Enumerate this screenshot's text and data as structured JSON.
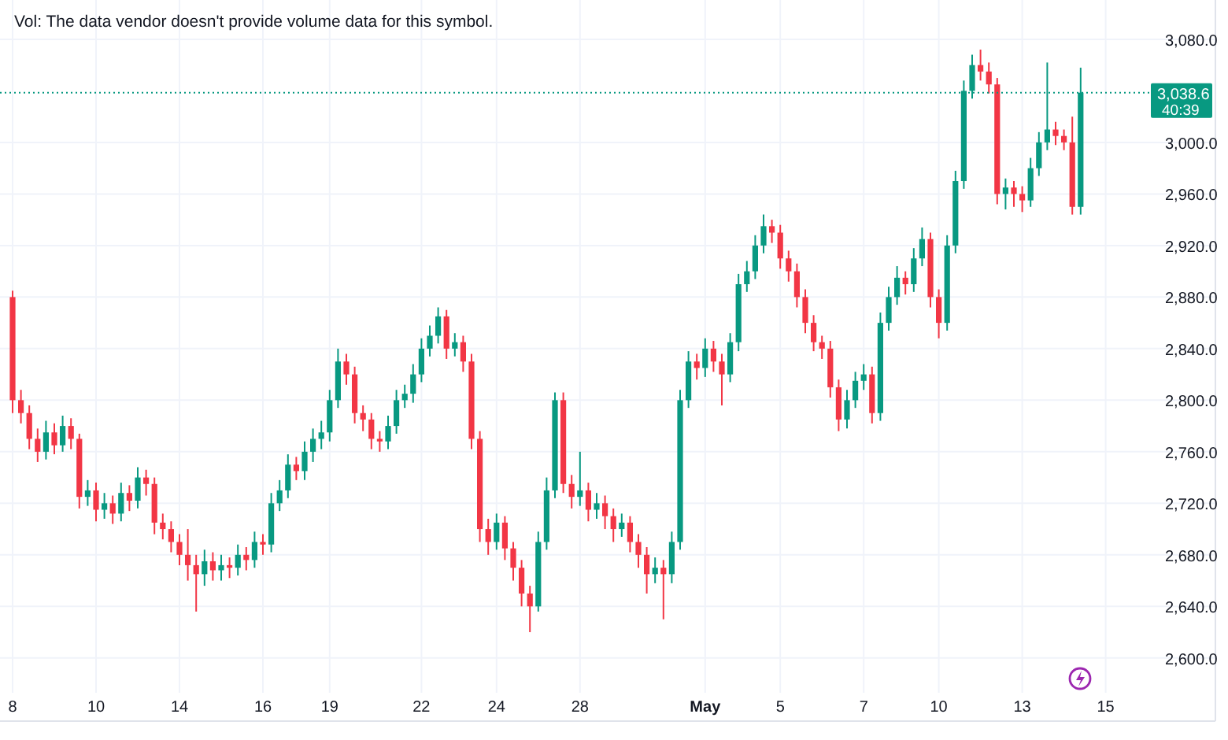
{
  "legend": {
    "volume_note": "Vol: The data vendor doesn't provide volume data for this symbol."
  },
  "chart": {
    "current_price": {
      "price": "3,038.6",
      "countdown": "40:39"
    },
    "chart_data": {
      "type": "candlestick",
      "categories": [
        "8",
        null,
        null,
        null,
        null,
        null,
        null,
        null,
        null,
        null,
        "10",
        null,
        null,
        null,
        null,
        null,
        null,
        null,
        null,
        null,
        "14",
        null,
        null,
        null,
        null,
        null,
        null,
        null,
        null,
        null,
        "16",
        null,
        null,
        null,
        null,
        null,
        null,
        null,
        "19",
        null,
        null,
        null,
        null,
        null,
        null,
        null,
        null,
        null,
        null,
        "22",
        null,
        null,
        null,
        null,
        null,
        null,
        null,
        null,
        "24",
        null,
        null,
        null,
        null,
        null,
        null,
        null,
        null,
        null,
        "28",
        null,
        null,
        null,
        null,
        null,
        null,
        null,
        null,
        null,
        null,
        null,
        null,
        null,
        null,
        "May",
        null,
        null,
        null,
        null,
        null,
        null,
        null,
        null,
        "5",
        null,
        null,
        null,
        null,
        null,
        null,
        null,
        null,
        null,
        "7",
        null,
        null,
        null,
        null,
        null,
        null,
        null,
        null,
        "10",
        null,
        null,
        null,
        null,
        null,
        null,
        null,
        null,
        null,
        "13",
        null,
        null,
        null,
        null,
        null,
        null,
        null,
        null,
        null,
        "15"
      ],
      "ohlc": [
        [
          2880,
          2885,
          2790,
          2800
        ],
        [
          2800,
          2808,
          2782,
          2790
        ],
        [
          2790,
          2796,
          2762,
          2770
        ],
        [
          2770,
          2778,
          2752,
          2760
        ],
        [
          2760,
          2784,
          2754,
          2775
        ],
        [
          2775,
          2782,
          2758,
          2765
        ],
        [
          2765,
          2788,
          2760,
          2780
        ],
        [
          2780,
          2786,
          2762,
          2770
        ],
        [
          2770,
          2774,
          2716,
          2725
        ],
        [
          2725,
          2738,
          2718,
          2730
        ],
        [
          2730,
          2736,
          2706,
          2715
        ],
        [
          2715,
          2728,
          2708,
          2720
        ],
        [
          2720,
          2726,
          2704,
          2712
        ],
        [
          2712,
          2736,
          2706,
          2728
        ],
        [
          2728,
          2734,
          2714,
          2722
        ],
        [
          2722,
          2748,
          2716,
          2740
        ],
        [
          2740,
          2746,
          2726,
          2735
        ],
        [
          2735,
          2740,
          2696,
          2705
        ],
        [
          2705,
          2712,
          2692,
          2700
        ],
        [
          2700,
          2706,
          2682,
          2690
        ],
        [
          2690,
          2696,
          2672,
          2680
        ],
        [
          2680,
          2700,
          2660,
          2672
        ],
        [
          2672,
          2680,
          2636,
          2665
        ],
        [
          2665,
          2684,
          2656,
          2675
        ],
        [
          2675,
          2682,
          2660,
          2668
        ],
        [
          2668,
          2680,
          2660,
          2672
        ],
        [
          2672,
          2678,
          2662,
          2670
        ],
        [
          2670,
          2688,
          2664,
          2680
        ],
        [
          2680,
          2686,
          2668,
          2676
        ],
        [
          2676,
          2698,
          2670,
          2690
        ],
        [
          2690,
          2696,
          2680,
          2688
        ],
        [
          2688,
          2728,
          2682,
          2720
        ],
        [
          2720,
          2738,
          2714,
          2730
        ],
        [
          2730,
          2758,
          2724,
          2750
        ],
        [
          2750,
          2756,
          2738,
          2745
        ],
        [
          2745,
          2768,
          2738,
          2760
        ],
        [
          2760,
          2778,
          2752,
          2770
        ],
        [
          2770,
          2784,
          2762,
          2775
        ],
        [
          2775,
          2808,
          2768,
          2800
        ],
        [
          2800,
          2840,
          2794,
          2830
        ],
        [
          2830,
          2836,
          2812,
          2820
        ],
        [
          2820,
          2826,
          2782,
          2790
        ],
        [
          2790,
          2796,
          2776,
          2785
        ],
        [
          2785,
          2790,
          2762,
          2770
        ],
        [
          2770,
          2776,
          2760,
          2768
        ],
        [
          2768,
          2788,
          2762,
          2780
        ],
        [
          2780,
          2808,
          2774,
          2800
        ],
        [
          2800,
          2812,
          2794,
          2805
        ],
        [
          2805,
          2828,
          2798,
          2820
        ],
        [
          2820,
          2848,
          2814,
          2840
        ],
        [
          2840,
          2858,
          2834,
          2850
        ],
        [
          2850,
          2872,
          2844,
          2865
        ],
        [
          2865,
          2870,
          2832,
          2840
        ],
        [
          2840,
          2852,
          2834,
          2845
        ],
        [
          2845,
          2850,
          2822,
          2830
        ],
        [
          2830,
          2836,
          2762,
          2770
        ],
        [
          2770,
          2776,
          2690,
          2700
        ],
        [
          2700,
          2708,
          2680,
          2690
        ],
        [
          2690,
          2712,
          2684,
          2705
        ],
        [
          2705,
          2710,
          2676,
          2685
        ],
        [
          2685,
          2690,
          2660,
          2670
        ],
        [
          2670,
          2676,
          2640,
          2650
        ],
        [
          2650,
          2656,
          2620,
          2640
        ],
        [
          2640,
          2698,
          2636,
          2690
        ],
        [
          2690,
          2740,
          2684,
          2730
        ],
        [
          2730,
          2806,
          2724,
          2800
        ],
        [
          2800,
          2806,
          2728,
          2735
        ],
        [
          2735,
          2742,
          2716,
          2725
        ],
        [
          2725,
          2760,
          2718,
          2730
        ],
        [
          2730,
          2736,
          2706,
          2715
        ],
        [
          2715,
          2728,
          2708,
          2720
        ],
        [
          2720,
          2726,
          2700,
          2710
        ],
        [
          2710,
          2716,
          2690,
          2700
        ],
        [
          2700,
          2712,
          2694,
          2705
        ],
        [
          2705,
          2710,
          2682,
          2690
        ],
        [
          2690,
          2696,
          2670,
          2680
        ],
        [
          2680,
          2686,
          2650,
          2665
        ],
        [
          2665,
          2678,
          2658,
          2670
        ],
        [
          2670,
          2676,
          2630,
          2665
        ],
        [
          2665,
          2698,
          2658,
          2690
        ],
        [
          2690,
          2808,
          2684,
          2800
        ],
        [
          2800,
          2838,
          2794,
          2830
        ],
        [
          2830,
          2836,
          2816,
          2825
        ],
        [
          2825,
          2848,
          2818,
          2840
        ],
        [
          2840,
          2846,
          2822,
          2830
        ],
        [
          2830,
          2836,
          2796,
          2820
        ],
        [
          2820,
          2852,
          2814,
          2845
        ],
        [
          2845,
          2898,
          2838,
          2890
        ],
        [
          2890,
          2908,
          2884,
          2900
        ],
        [
          2900,
          2928,
          2894,
          2920
        ],
        [
          2920,
          2944,
          2914,
          2935
        ],
        [
          2935,
          2940,
          2922,
          2930
        ],
        [
          2930,
          2936,
          2902,
          2910
        ],
        [
          2910,
          2916,
          2892,
          2900
        ],
        [
          2900,
          2906,
          2872,
          2880
        ],
        [
          2880,
          2886,
          2852,
          2860
        ],
        [
          2860,
          2866,
          2838,
          2845
        ],
        [
          2845,
          2850,
          2832,
          2840
        ],
        [
          2840,
          2846,
          2802,
          2810
        ],
        [
          2810,
          2816,
          2776,
          2785
        ],
        [
          2785,
          2808,
          2778,
          2800
        ],
        [
          2800,
          2822,
          2794,
          2815
        ],
        [
          2815,
          2828,
          2808,
          2820
        ],
        [
          2820,
          2826,
          2782,
          2790
        ],
        [
          2790,
          2868,
          2784,
          2860
        ],
        [
          2860,
          2888,
          2854,
          2880
        ],
        [
          2880,
          2904,
          2874,
          2895
        ],
        [
          2895,
          2900,
          2882,
          2890
        ],
        [
          2890,
          2918,
          2884,
          2910
        ],
        [
          2910,
          2934,
          2904,
          2925
        ],
        [
          2925,
          2930,
          2872,
          2880
        ],
        [
          2880,
          2886,
          2848,
          2860
        ],
        [
          2860,
          2928,
          2854,
          2920
        ],
        [
          2920,
          2978,
          2914,
          2970
        ],
        [
          2970,
          3048,
          2964,
          3040
        ],
        [
          3040,
          3068,
          3034,
          3060
        ],
        [
          3060,
          3072,
          3048,
          3055
        ],
        [
          3055,
          3062,
          3038,
          3045
        ],
        [
          3045,
          3050,
          2952,
          2960
        ],
        [
          2960,
          2972,
          2948,
          2965
        ],
        [
          2965,
          2970,
          2950,
          2960
        ],
        [
          2960,
          2966,
          2946,
          2955
        ],
        [
          2955,
          2988,
          2950,
          2980
        ],
        [
          2980,
          3008,
          2974,
          3000
        ],
        [
          3000,
          3062,
          2994,
          3010
        ],
        [
          3010,
          3016,
          2998,
          3005
        ],
        [
          3005,
          3010,
          2994,
          3000
        ],
        [
          3000,
          3020,
          2944,
          2950
        ],
        [
          2950,
          3058,
          2944,
          3038.6
        ],
        null,
        null,
        null
      ],
      "ylim": [
        2551,
        3110.5
      ],
      "yticks": [
        {
          "value": 3080,
          "label": "3,080.0"
        },
        {
          "value": 3000,
          "label": "3,000.0"
        },
        {
          "value": 2960,
          "label": "2,960.0"
        },
        {
          "value": 2920,
          "label": "2,920.0"
        },
        {
          "value": 2880,
          "label": "2,880.0"
        },
        {
          "value": 2840,
          "label": "2,840.0"
        },
        {
          "value": 2800,
          "label": "2,800.0"
        },
        {
          "value": 2760,
          "label": "2,760.0"
        },
        {
          "value": 2720,
          "label": "2,720.0"
        },
        {
          "value": 2680,
          "label": "2,680.0"
        },
        {
          "value": 2640,
          "label": "2,640.0"
        },
        {
          "value": 2600,
          "label": "2,600.0"
        }
      ],
      "grid": true,
      "ref_lines": [
        {
          "axis": "y",
          "value": 3038.6,
          "color": "#089981"
        }
      ]
    },
    "time_labels": [
      {
        "bold": false
      },
      {
        "bold": false
      },
      {
        "bold": false
      },
      {
        "bold": false
      },
      {
        "bold": false
      },
      {
        "bold": false
      },
      {
        "bold": false
      },
      {
        "bold": false
      },
      {
        "bold": true
      },
      {
        "bold": false
      },
      {
        "bold": false
      },
      {
        "bold": false
      },
      {
        "bold": false
      },
      {
        "bold": false
      }
    ]
  }
}
